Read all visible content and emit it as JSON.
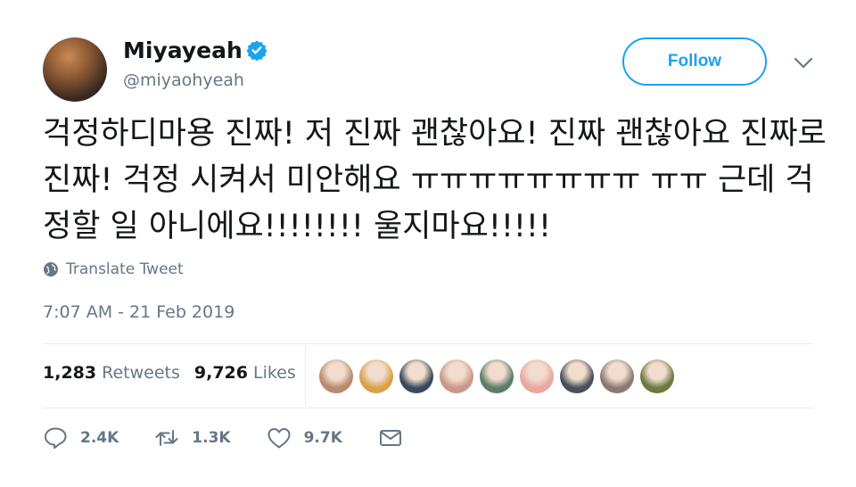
{
  "user": {
    "display_name": "Miyayeah",
    "handle": "@miyaohyeah",
    "verified": true
  },
  "header": {
    "follow_label": "Follow"
  },
  "tweet": {
    "text": "걱정하디마용 진짜! 저 진짜 괜찮아요! 진짜 괜찮아요 진짜로 진짜! 걱정 시켜서 미안해요 ㅠㅠㅠㅠㅠㅠㅠㅠ ㅠㅠ 근데 걱정할 일 아니에요!!!!!!!! 울지마요!!!!!",
    "translate_label": "Translate Tweet",
    "timestamp": "7:07 AM - 21 Feb 2019"
  },
  "stats": {
    "retweets_count": "1,283",
    "retweets_label": "Retweets",
    "likes_count": "9,726",
    "likes_label": "Likes"
  },
  "likers": [
    {
      "color": "#b98b70"
    },
    {
      "color": "#d9a24a"
    },
    {
      "color": "#394a5e"
    },
    {
      "color": "#c89a8a"
    },
    {
      "color": "#5c7d68"
    },
    {
      "color": "#e8a7a0"
    },
    {
      "color": "#48505a"
    },
    {
      "color": "#8a7a70"
    },
    {
      "color": "#6a7a40"
    }
  ],
  "actions": {
    "reply_count": "2.4K",
    "retweet_count": "1.3K",
    "like_count": "9.7K"
  },
  "colors": {
    "accent": "#1da1f2",
    "secondary_text": "#657786",
    "divider": "#e6ecf0"
  }
}
